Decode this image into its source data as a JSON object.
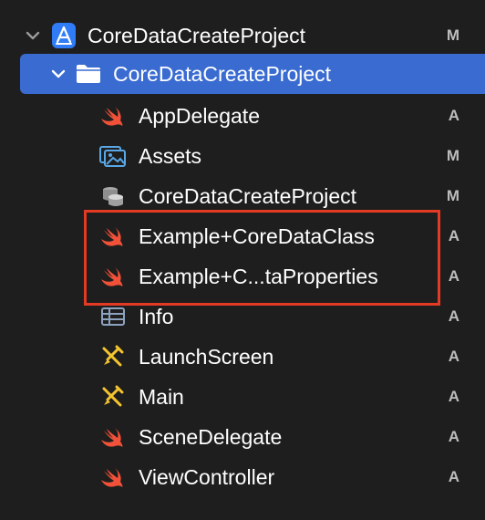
{
  "project": {
    "name": "CoreDataCreateProject",
    "status": "M",
    "icon": "xcode-project-icon",
    "expanded": true
  },
  "group": {
    "name": "CoreDataCreateProject",
    "icon": "folder-icon",
    "expanded": true,
    "selected": true
  },
  "files": [
    {
      "label": "AppDelegate",
      "status": "A",
      "icon": "swift-icon"
    },
    {
      "label": "Assets",
      "status": "M",
      "icon": "asset-catalog-icon"
    },
    {
      "label": "CoreDataCreateProject",
      "status": "M",
      "icon": "core-data-model-icon"
    },
    {
      "label": "Example+CoreDataClass",
      "status": "A",
      "icon": "swift-icon"
    },
    {
      "label": "Example+C...taProperties",
      "status": "A",
      "icon": "swift-icon"
    },
    {
      "label": "Info",
      "status": "A",
      "icon": "plist-icon"
    },
    {
      "label": "LaunchScreen",
      "status": "A",
      "icon": "storyboard-icon"
    },
    {
      "label": "Main",
      "status": "A",
      "icon": "storyboard-icon"
    },
    {
      "label": "SceneDelegate",
      "status": "A",
      "icon": "swift-icon"
    },
    {
      "label": "ViewController",
      "status": "A",
      "icon": "swift-icon"
    }
  ],
  "colors": {
    "background": "#1e1e1e",
    "selection": "#3a6bd1",
    "swift": "#f05138",
    "highlight_box": "#e23a23",
    "status_text": "#bdbdbd"
  }
}
